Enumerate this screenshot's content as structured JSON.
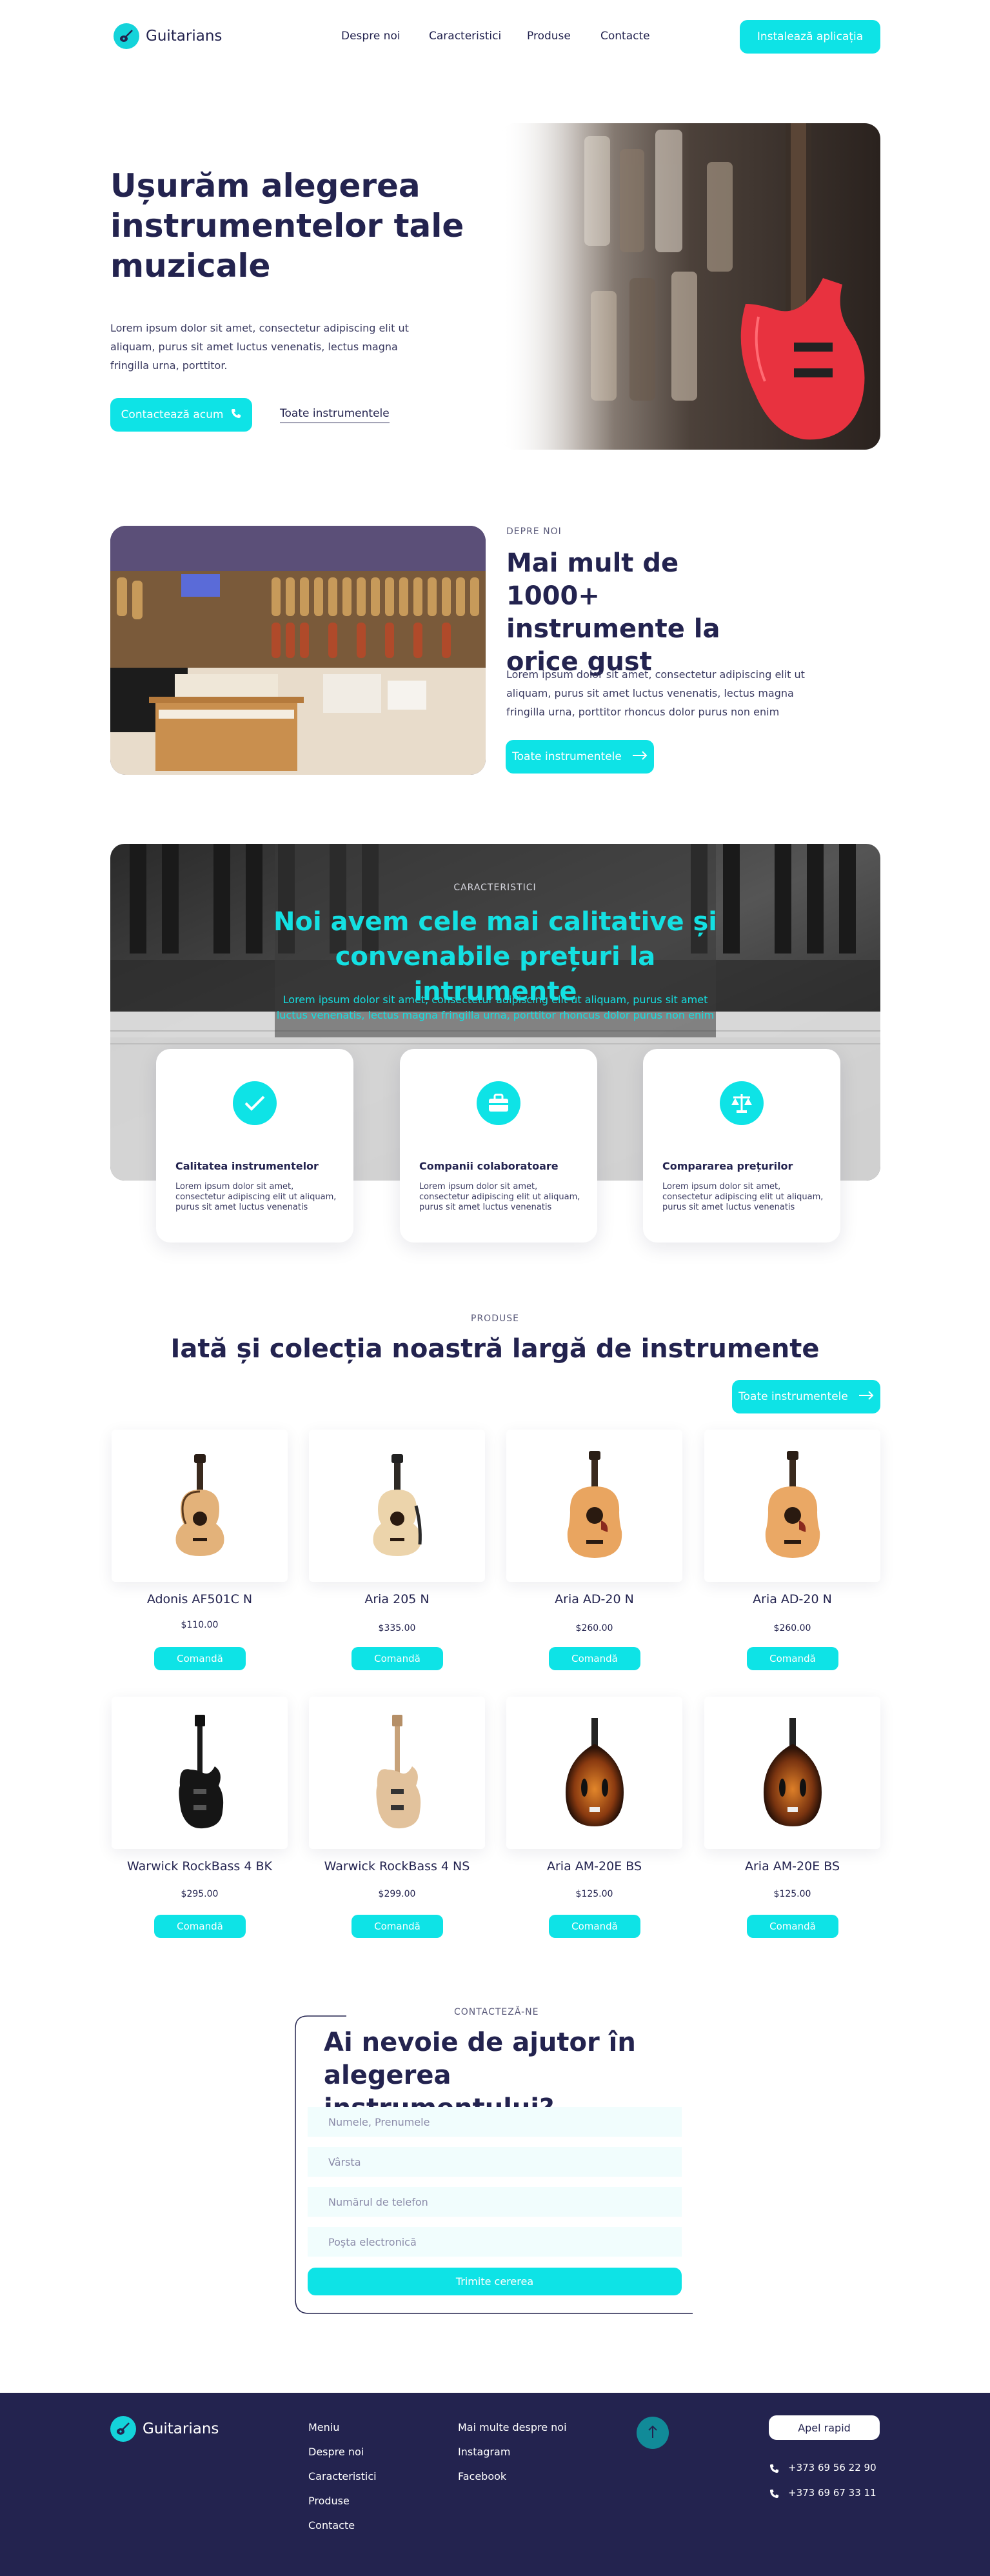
{
  "header": {
    "brand": "Guitarians",
    "nav": [
      "Despre noi",
      "Caracteristici",
      "Produse",
      "Contacte"
    ],
    "cta": "Instalează aplicația"
  },
  "hero": {
    "title": "Ușurăm alegerea instrumentelor tale muzicale",
    "text": "Lorem ipsum dolor sit amet, consectetur adipiscing elit ut aliquam, purus sit amet luctus venenatis, lectus magna fringilla urna, porttitor.",
    "contact_btn": "Contactează acum",
    "all_link": "Toate instrumentele"
  },
  "about": {
    "label": "DEPRE NOI",
    "title": "Mai mult de 1000+ instrumente la orice gust",
    "text": "Lorem ipsum dolor sit amet, consectetur adipiscing elit ut aliquam, purus sit amet luctus venenatis, lectus magna fringilla urna, porttitor rhoncus dolor purus non enim",
    "btn": "Toate instrumentele"
  },
  "features": {
    "label": "CARACTERISTICI",
    "title": "Noi avem cele mai calitative și convenabile prețuri la intrumente",
    "text": "Lorem ipsum dolor sit amet, consectetur adipiscing elit ut aliquam, purus sit amet luctus venenatis, lectus magna fringilla urna, porttitor rhoncus dolor purus non enim",
    "cards": [
      {
        "title": "Calitatea instrumentelor",
        "text": "Lorem ipsum dolor sit amet, consectetur adipiscing elit ut aliquam, purus sit amet luctus venenatis",
        "icon": "check-icon"
      },
      {
        "title": "Companii colaboratoare",
        "text": "Lorem ipsum dolor sit amet, consectetur adipiscing elit ut aliquam, purus sit amet luctus venenatis",
        "icon": "briefcase-icon"
      },
      {
        "title": "Compararea prețurilor",
        "text": "Lorem ipsum dolor sit amet, consectetur adipiscing elit ut aliquam, purus sit amet luctus venenatis",
        "icon": "scales-icon"
      }
    ]
  },
  "products": {
    "label": "PRODUSE",
    "title": "Iată și colecția noastră largă de instrumente",
    "all_btn": "Toate instrumentele",
    "order_label": "Comandă",
    "items": [
      {
        "name": "Adonis AF501C N",
        "price": "$110.00"
      },
      {
        "name": "Aria 205 N",
        "price": "$335.00"
      },
      {
        "name": "Aria AD-20 N",
        "price": "$260.00"
      },
      {
        "name": "Aria AD-20 N",
        "price": "$260.00"
      },
      {
        "name": "Warwick RockBass 4 BK",
        "price": "$295.00"
      },
      {
        "name": "Warwick RockBass 4 NS",
        "price": "$299.00"
      },
      {
        "name": "Aria AM-20E BS",
        "price": "$125.00"
      },
      {
        "name": "Aria AM-20E BS",
        "price": "$125.00"
      }
    ]
  },
  "contact": {
    "label": "CONTACTEZĂ-NE",
    "title": "Ai nevoie de ajutor în alegerea instrumentului?",
    "placeholders": [
      "Numele, Prenumele",
      "Vârsta",
      "Numărul de telefon",
      "Poșta electronică"
    ],
    "submit": "Trimite cererea"
  },
  "footer": {
    "brand": "Guitarians",
    "col1": [
      "Meniu",
      "Despre noi",
      "Caracteristici",
      "Produse",
      "Contacte"
    ],
    "col2": [
      "Mai multe despre noi",
      "Instagram",
      "Facebook"
    ],
    "quick_call": "Apel rapid",
    "phones": [
      "+373 69 56 22 90",
      "+373 69 67 33 11"
    ]
  },
  "colors": {
    "accent": "#0ee3e6",
    "navy": "#23234f",
    "guitar_red": "#e8323f"
  }
}
